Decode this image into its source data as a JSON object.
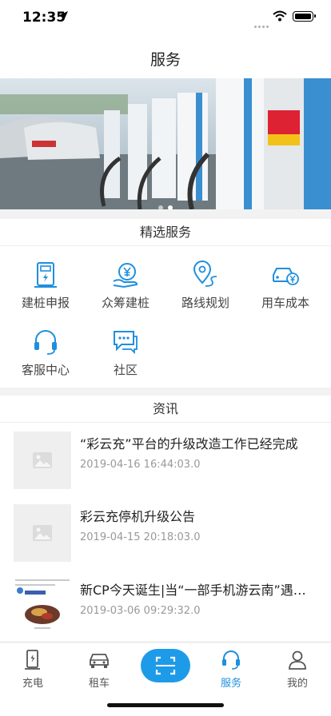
{
  "status_bar": {
    "time": "12:35"
  },
  "nav": {
    "title": "服务"
  },
  "banner": {
    "slides": 2,
    "active_slide": 1
  },
  "featured": {
    "header": "精选服务",
    "items": [
      {
        "label": "建桩申报",
        "icon": "charging-post-icon"
      },
      {
        "label": "众筹建桩",
        "icon": "yen-hand-icon"
      },
      {
        "label": "路线规划",
        "icon": "route-pin-icon"
      },
      {
        "label": "用车成本",
        "icon": "car-yen-icon"
      },
      {
        "label": "客服中心",
        "icon": "headset-icon"
      },
      {
        "label": "社区",
        "icon": "chat-bubbles-icon"
      }
    ]
  },
  "news": {
    "header": "资讯",
    "items": [
      {
        "title": "“彩云充”平台的升级改造工作已经完成",
        "date": "2019-04-16 16:44:03.0"
      },
      {
        "title": "彩云充停机升级公告",
        "date": "2019-04-15 20:18:03.0"
      },
      {
        "title": "新CP今天诞生|当“一部手机游云南”遇…",
        "date": "2019-03-06 09:29:32.0"
      }
    ]
  },
  "tabs": [
    {
      "label": "充电",
      "icon": "charger-icon"
    },
    {
      "label": "租车",
      "icon": "car-icon"
    },
    {
      "label": "",
      "icon": "scan-icon"
    },
    {
      "label": "服务",
      "icon": "service-headset-icon",
      "active": true
    },
    {
      "label": "我的",
      "icon": "user-icon"
    }
  ],
  "colors": {
    "accent": "#1e8fde",
    "scan_button": "#1e9be8",
    "background": "#f2f2f2"
  }
}
